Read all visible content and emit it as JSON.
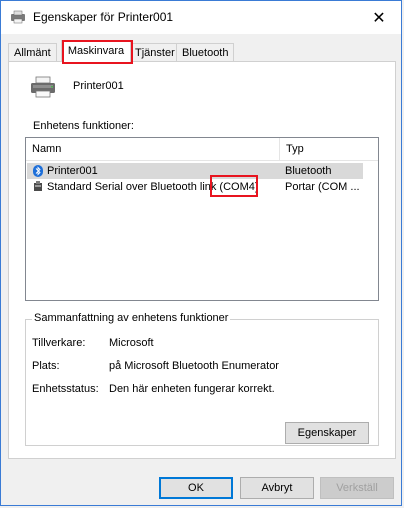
{
  "window": {
    "title": "Egenskaper för Printer001",
    "close_glyph": "✕",
    "accent_color": "#3a7bd5",
    "highlight_color": "#e8141f"
  },
  "tabs": [
    {
      "label": "Allmänt"
    },
    {
      "label": "Maskinvara",
      "active": true
    },
    {
      "label": "Tjänster"
    },
    {
      "label": "Bluetooth"
    }
  ],
  "device": {
    "name": "Printer001",
    "icon": "printer-icon"
  },
  "functions": {
    "section_label": "Enhetens funktioner:",
    "columns": {
      "name": "Namn",
      "type": "Typ"
    },
    "rows": [
      {
        "name": "Printer001",
        "type": "Bluetooth",
        "icon": "bluetooth-icon",
        "selected": true
      },
      {
        "name": "Standard Serial over Bluetooth link (COM4)",
        "type": "Portar (COM ...",
        "icon": "port-icon",
        "selected": false
      }
    ]
  },
  "summary": {
    "title": "Sammanfattning av enhetens funktioner",
    "manufacturer_label": "Tillverkare:",
    "manufacturer_value": "Microsoft",
    "location_label": "Plats:",
    "location_value": "på Microsoft Bluetooth Enumerator",
    "status_label": "Enhetsstatus:",
    "status_value": "Den här enheten fungerar korrekt.",
    "properties_button": "Egenskaper"
  },
  "buttons": {
    "ok": "OK",
    "cancel": "Avbryt",
    "apply": "Verkställ"
  }
}
